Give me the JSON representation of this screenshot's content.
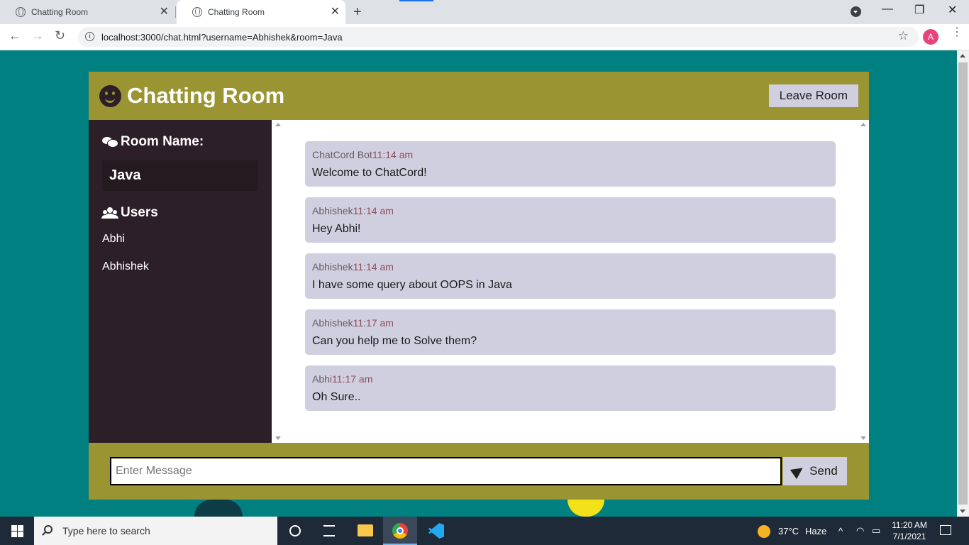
{
  "browser": {
    "tabs": [
      {
        "title": "Chatting Room",
        "active": false
      },
      {
        "title": "Chatting Room",
        "active": true
      }
    ],
    "url": "localhost:3000/chat.html?username=Abhishek&room=Java",
    "profile_initial": "A",
    "window_controls": {
      "minimize": "—",
      "restore": "❐",
      "close": "✕"
    },
    "nav": {
      "back": "←",
      "forward": "→",
      "reload": "↻"
    },
    "icons": {
      "new_tab": "+",
      "star": "☆",
      "menu": "⋮",
      "close_tab": "✕"
    }
  },
  "page": {
    "header": {
      "title": "Chatting Room",
      "leave_button": "Leave Room"
    },
    "sidebar": {
      "room_heading": "Room Name:",
      "room_name": "Java",
      "users_heading": "Users",
      "users": [
        "Abhi",
        "Abhishek"
      ]
    },
    "messages": [
      {
        "username": "ChatCord Bot",
        "time": "11:14 am",
        "text": "Welcome to ChatCord!"
      },
      {
        "username": "Abhishek",
        "time": "11:14 am",
        "text": "Hey Abhi!"
      },
      {
        "username": "Abhishek",
        "time": "11:14 am",
        "text": "I have some query about OOPS in Java"
      },
      {
        "username": "Abhishek",
        "time": "11:17 am",
        "text": "Can you help me to Solve them?"
      },
      {
        "username": "Abhi",
        "time": "11:17 am",
        "text": "Oh Sure.."
      }
    ],
    "form": {
      "placeholder": "Enter Message",
      "send_button": "Send"
    }
  },
  "taskbar": {
    "search_placeholder": "Type here to search",
    "weather": {
      "temp": "37°C",
      "condition": "Haze"
    },
    "clock": {
      "time": "11:20 AM",
      "date": "7/1/2021"
    },
    "tray_chevron": "^"
  },
  "colors": {
    "page_bg": "#008080",
    "header_bg": "#9b9433",
    "sidebar_bg": "#2d1f27",
    "message_bg": "#d0cfe0"
  }
}
